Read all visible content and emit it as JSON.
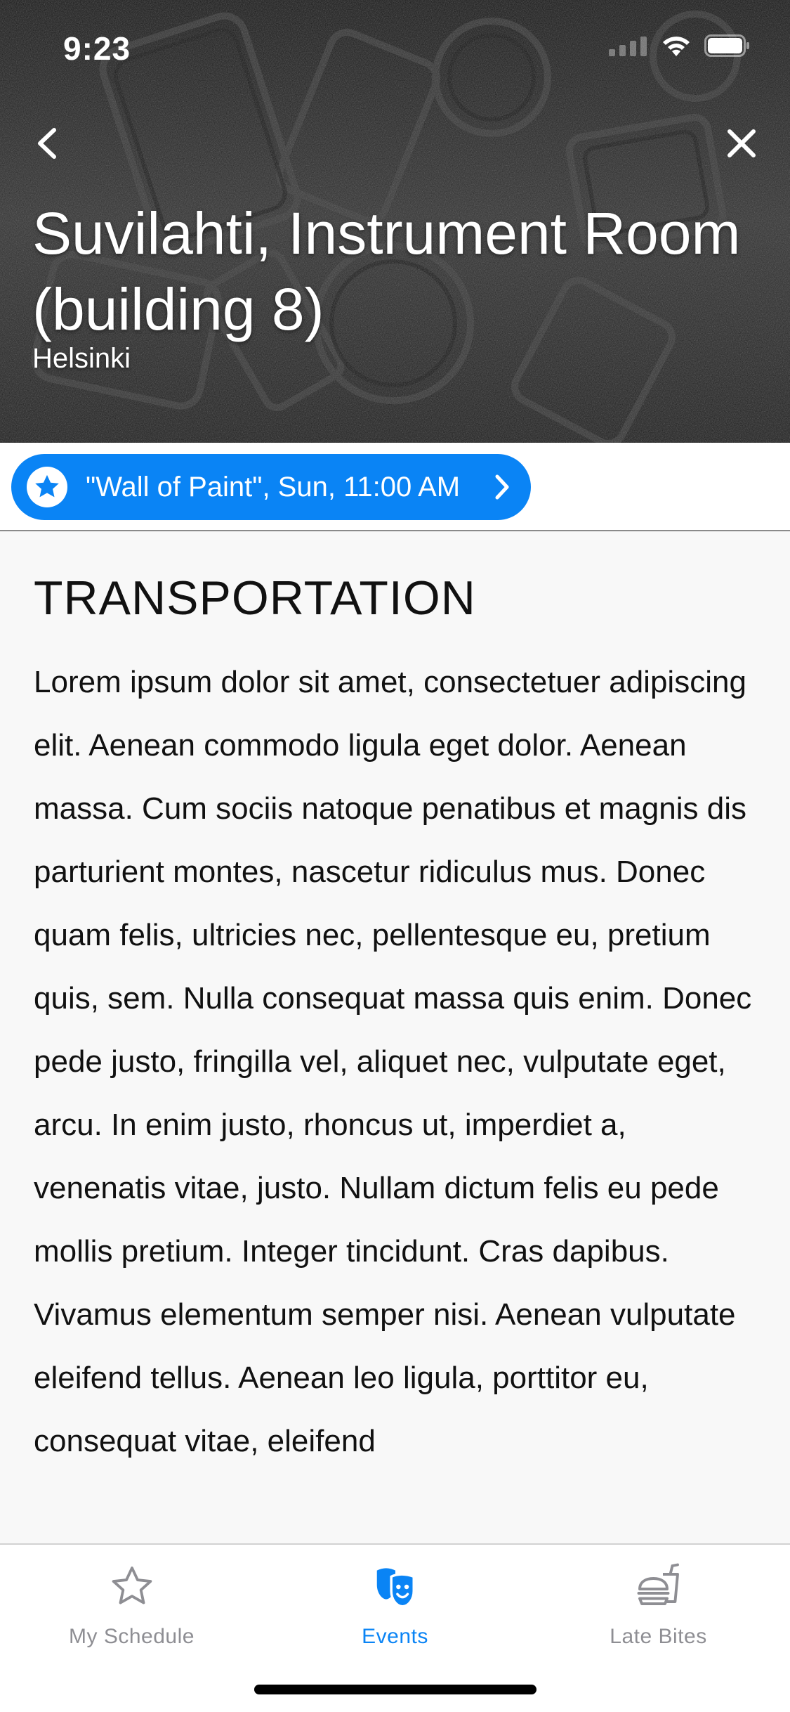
{
  "status_bar": {
    "time": "9:23"
  },
  "header": {
    "title": "Suvilahti, Instrument Room (building 8)",
    "city": "Helsinki"
  },
  "event_pill": {
    "label": "\"Wall of Paint\", Sun, 11:00 AM"
  },
  "content": {
    "heading": "TRANSPORTATION",
    "body": "Lorem ipsum dolor sit amet, consectetuer adipiscing elit. Aenean commodo ligula eget dolor. Aenean massa. Cum sociis natoque penatibus et magnis dis parturient montes, nascetur ridiculus mus. Donec quam felis, ultricies nec, pellentesque eu, pretium quis, sem. Nulla consequat massa quis enim. Donec pede justo, fringilla vel, aliquet nec, vulputate eget, arcu. In enim justo, rhoncus ut, imperdiet a, venenatis vitae, justo. Nullam dictum felis eu pede mollis pretium. Integer tincidunt. Cras dapibus. Vivamus elementum semper nisi. Aenean vulputate eleifend tellus. Aenean leo ligula, porttitor eu, consequat vitae, eleifend"
  },
  "tab_bar": {
    "tabs": [
      {
        "label": "My Schedule",
        "icon": "star-icon",
        "active": false
      },
      {
        "label": "Events",
        "icon": "theater-masks-icon",
        "active": true
      },
      {
        "label": "Late Bites",
        "icon": "burger-drink-icon",
        "active": false
      }
    ]
  },
  "colors": {
    "accent": "#0a84f5",
    "tab_inactive": "#8e8e93",
    "text": "#111111",
    "content_bg": "#f8f8f8"
  }
}
